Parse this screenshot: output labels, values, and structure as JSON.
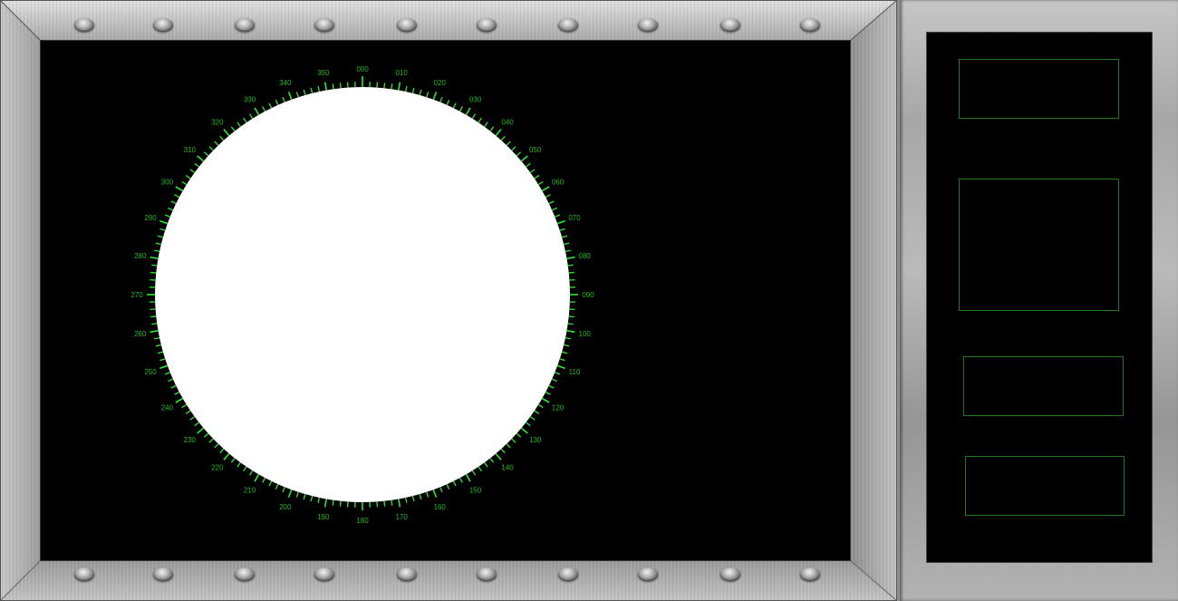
{
  "colors": {
    "scale_green": "#2ee82e",
    "label_green": "#22b822",
    "screen": "#000000",
    "dial_face": "#ffffff",
    "box_border": "#1f7a1f"
  },
  "compass": {
    "labels": [
      "000",
      "010",
      "020",
      "030",
      "040",
      "050",
      "060",
      "070",
      "080",
      "090",
      "100",
      "110",
      "120",
      "130",
      "140",
      "150",
      "160",
      "170",
      "180",
      "190",
      "200",
      "210",
      "220",
      "230",
      "240",
      "250",
      "260",
      "270",
      "280",
      "290",
      "300",
      "310",
      "320",
      "330",
      "340",
      "350"
    ]
  },
  "side_panel": {
    "boxes": [
      {
        "id": "readout-1"
      },
      {
        "id": "readout-2"
      },
      {
        "id": "readout-3"
      },
      {
        "id": "readout-4"
      }
    ]
  }
}
